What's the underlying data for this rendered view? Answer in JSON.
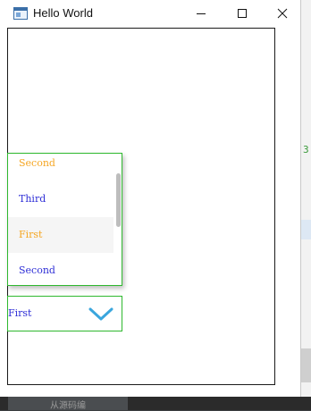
{
  "window": {
    "title": "Hello World",
    "buttons": {
      "minimize": "minimize",
      "maximize": "maximize",
      "close": "close"
    }
  },
  "popup": {
    "items": [
      {
        "label": "Second",
        "color": "#f5a623"
      },
      {
        "label": "Third",
        "color": "#2e2ed6"
      },
      {
        "label": "First",
        "color": "#f5a623"
      },
      {
        "label": "Second",
        "color": "#2e2ed6"
      }
    ],
    "hovered_index": 2,
    "scroll_position": 0.25
  },
  "combo": {
    "selected": "First",
    "arrow_icon": "chevron-down-icon",
    "accent": "#3aa6dd",
    "border": "#2eb82e"
  },
  "background": {
    "right_mark": "3",
    "bottom_label": "从源码编"
  }
}
